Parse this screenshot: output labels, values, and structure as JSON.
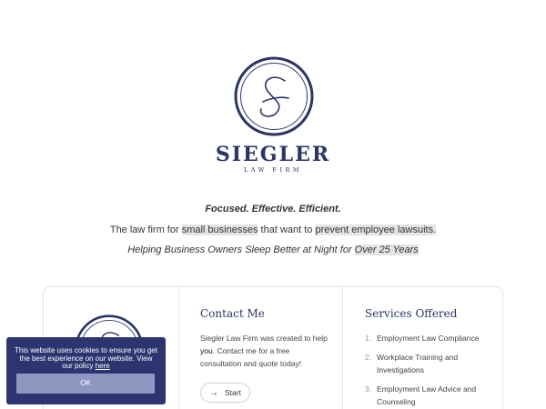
{
  "brand": {
    "monogram": "S",
    "name": "SIEGLER",
    "subtitle": "LAW FIRM"
  },
  "hero": {
    "tagline": "Focused. Effective. Efficient.",
    "line2": {
      "pre": "The law firm for ",
      "hl1": "small businesses",
      "mid": " that want to ",
      "hl2": "prevent employee lawsuits."
    },
    "line3": {
      "pre": "Helping Business Owners Sleep Better at Night for ",
      "hl": "Over 25 Years"
    }
  },
  "contact": {
    "title": "Contact Me",
    "text_pre": "Siegler Law Firm was created to help ",
    "text_bold": "you",
    "text_post": ". Contact me for a free consultation and quote today!",
    "button_label": "Start",
    "button_icon": "arrow-right-icon"
  },
  "services": {
    "title": "Services Offered",
    "items": [
      {
        "num": "1.",
        "label": "Employment Law Compliance"
      },
      {
        "num": "2.",
        "label": "Workplace Training and Investigations"
      },
      {
        "num": "3.",
        "label": "Employment Law Advice and Counseling"
      }
    ]
  },
  "cookie": {
    "text": "This website uses cookies to ensure you get the best experience on our website. View our policy",
    "link_label": "here",
    "ok_label": "OK"
  },
  "colors": {
    "brand_navy": "#2c3566",
    "cookie_bg": "#2c3570",
    "ok_button": "#8f97c1"
  }
}
